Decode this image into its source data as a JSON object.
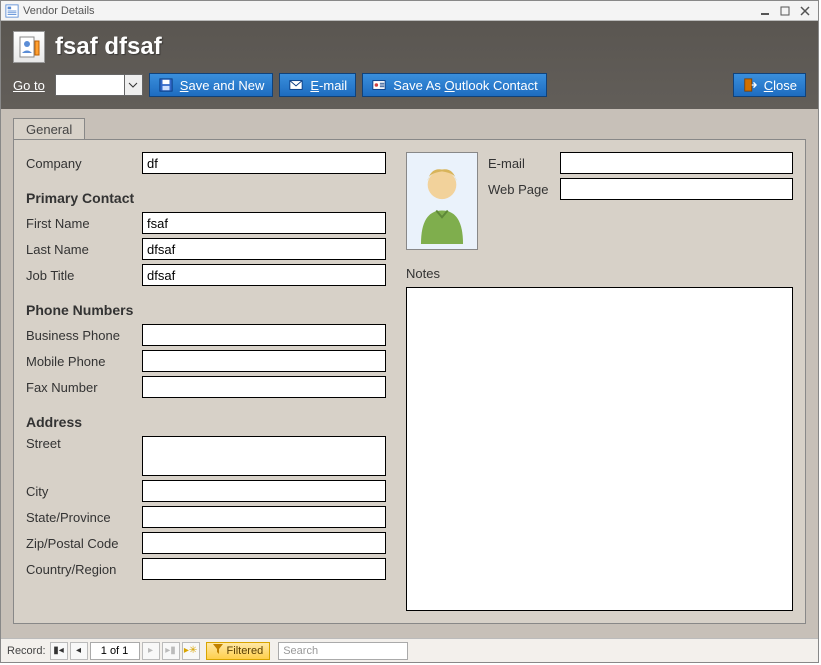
{
  "window": {
    "title": "Vendor Details"
  },
  "header": {
    "title": "fsaf dfsaf",
    "goto_label": "Go to"
  },
  "toolbar": {
    "goto_value": "",
    "save_new": {
      "pre": "",
      "u": "S",
      "post": "ave and New"
    },
    "email": {
      "pre": "",
      "u": "E",
      "post": "-mail"
    },
    "outlook": {
      "pre": "Save As ",
      "u": "O",
      "post": "utlook Contact"
    },
    "close": {
      "pre": "",
      "u": "C",
      "post": "lose"
    }
  },
  "tabs": {
    "general": "General"
  },
  "labels": {
    "company": "Company",
    "primary_contact": "Primary Contact",
    "first_name": "First Name",
    "last_name": "Last Name",
    "job_title": "Job Title",
    "phone_numbers": "Phone Numbers",
    "business_phone": "Business Phone",
    "mobile_phone": "Mobile Phone",
    "fax_number": "Fax Number",
    "address": "Address",
    "street": "Street",
    "city": "City",
    "state": "State/Province",
    "zip": "Zip/Postal Code",
    "country": "Country/Region",
    "email": "E-mail",
    "webpage": "Web Page",
    "notes": "Notes"
  },
  "values": {
    "company": "df",
    "first_name": "fsaf",
    "last_name": "dfsaf",
    "job_title": "dfsaf",
    "business_phone": "",
    "mobile_phone": "",
    "fax_number": "",
    "street": "",
    "city": "",
    "state": "",
    "zip": "",
    "country": "",
    "email": "",
    "webpage": "",
    "notes": ""
  },
  "nav": {
    "record_label": "Record:",
    "position": "1 of 1",
    "filtered": "Filtered",
    "search_placeholder": "Search"
  }
}
